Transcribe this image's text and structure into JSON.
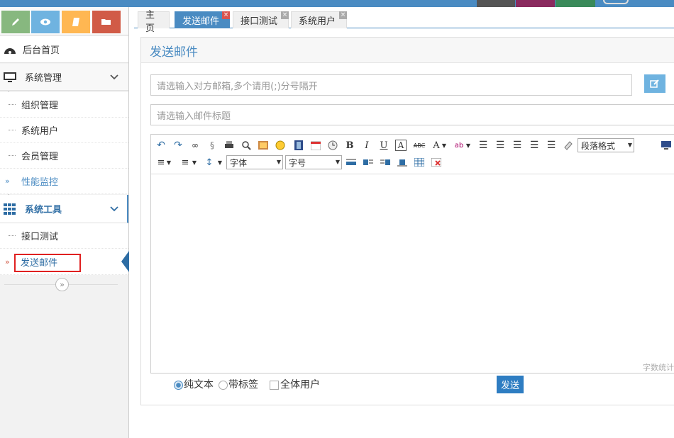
{
  "colors": {
    "accent": "#4a8bc2",
    "green": "#87b87f",
    "cyan": "#6fb3e0",
    "yellow": "#ffb752",
    "red": "#d15b47",
    "highlight_box": "#e02020"
  },
  "shortcuts": [
    {
      "icon": "pencil-icon"
    },
    {
      "icon": "eye-icon"
    },
    {
      "icon": "book-icon"
    },
    {
      "icon": "folder-icon"
    }
  ],
  "sidebar": {
    "dashboard": "后台首页",
    "system_mgmt": "系统管理",
    "system_items": [
      "组织管理",
      "系统用户",
      "会员管理",
      "性能监控"
    ],
    "system_tools": "系统工具",
    "tool_items": [
      "接口测试",
      "发送邮件"
    ]
  },
  "tabs": [
    "主页",
    "发送邮件",
    "接口测试",
    "系统用户"
  ],
  "tab_close": "×",
  "panel": {
    "title": "发送邮件",
    "to_placeholder": "请选输入对方邮箱,多个请用(;)分号隔开",
    "subject_placeholder": "请选输入邮件标题"
  },
  "toolbar": {
    "bold": "B",
    "italic": "I",
    "underline": "U",
    "font_color": "A",
    "strike": "ABC",
    "paragraph": "段落格式",
    "font_family": "字体",
    "font_size": "字号"
  },
  "editor": {
    "word_count": "字数统计"
  },
  "options": {
    "plain": "纯文本",
    "tagged": "带标签",
    "all_users": "全体用户"
  },
  "send_button": "发送"
}
